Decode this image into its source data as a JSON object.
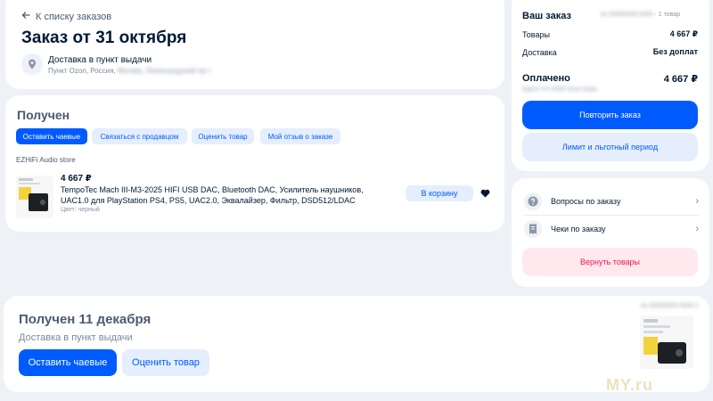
{
  "header": {
    "back_link": "К списку заказов",
    "title": "Заказ от 31 октября",
    "delivery_type": "Доставка в пункт выдачи",
    "address_prefix": "Пункт Ozon, Россия,",
    "address_hidden": "Москва, Ленинградский пр-т"
  },
  "received_card": {
    "status": "Получен",
    "chips": [
      "Оставить чаевые",
      "Связаться с продавцом",
      "Оценить товар",
      "Мой отзыв о заказе"
    ],
    "store_name": "EZHiFi Audio store",
    "product": {
      "price": "4 667 ₽",
      "name": "TempoTec Mach III-M3-2025 HIFI USB DAC, Bluetooth DAC, Усилитель наушников, UAC1.0 для PlayStation PS4, PS5, UAC2.0, Эквалайзер, Фильтр, DSD512/LDAC",
      "color": "Цвет: черный",
      "cart_button": "В корзину"
    }
  },
  "summary": {
    "title": "Ваш заказ",
    "order_number_hidden": "№ 00000000-0000",
    "items_count": "· 1 товар",
    "rows": [
      {
        "label": "Товары",
        "value": "4 667 ₽"
      },
      {
        "label": "Доставка",
        "value": "Без доплат"
      }
    ],
    "paid_label": "Оплачено",
    "paid_value": "4 667 ₽",
    "paid_sub_hidden": "Карта •••• 0000 Ozon Банк",
    "repeat_button": "Повторить заказ",
    "limit_button": "Лимит и льготный период"
  },
  "help": {
    "items": [
      {
        "label": "Вопросы по заказу",
        "icon": "question-icon"
      },
      {
        "label": "Чеки по заказу",
        "icon": "receipt-icon"
      }
    ],
    "return_button": "Вернуть товары"
  },
  "shipment": {
    "title": "Получен 11 декабря",
    "subtitle": "Доставка в пункт выдачи",
    "tip_button": "Оставить чаевые",
    "rate_button": "Оценить товар",
    "shipment_number_hidden": "№ 00000000-0000-1"
  },
  "watermark": "MY.ru",
  "colors": {
    "primary": "#005bff",
    "primary_light": "#e5eefc",
    "danger": "#f91155",
    "danger_light": "#ffe9ee",
    "background": "#eef1f5"
  }
}
